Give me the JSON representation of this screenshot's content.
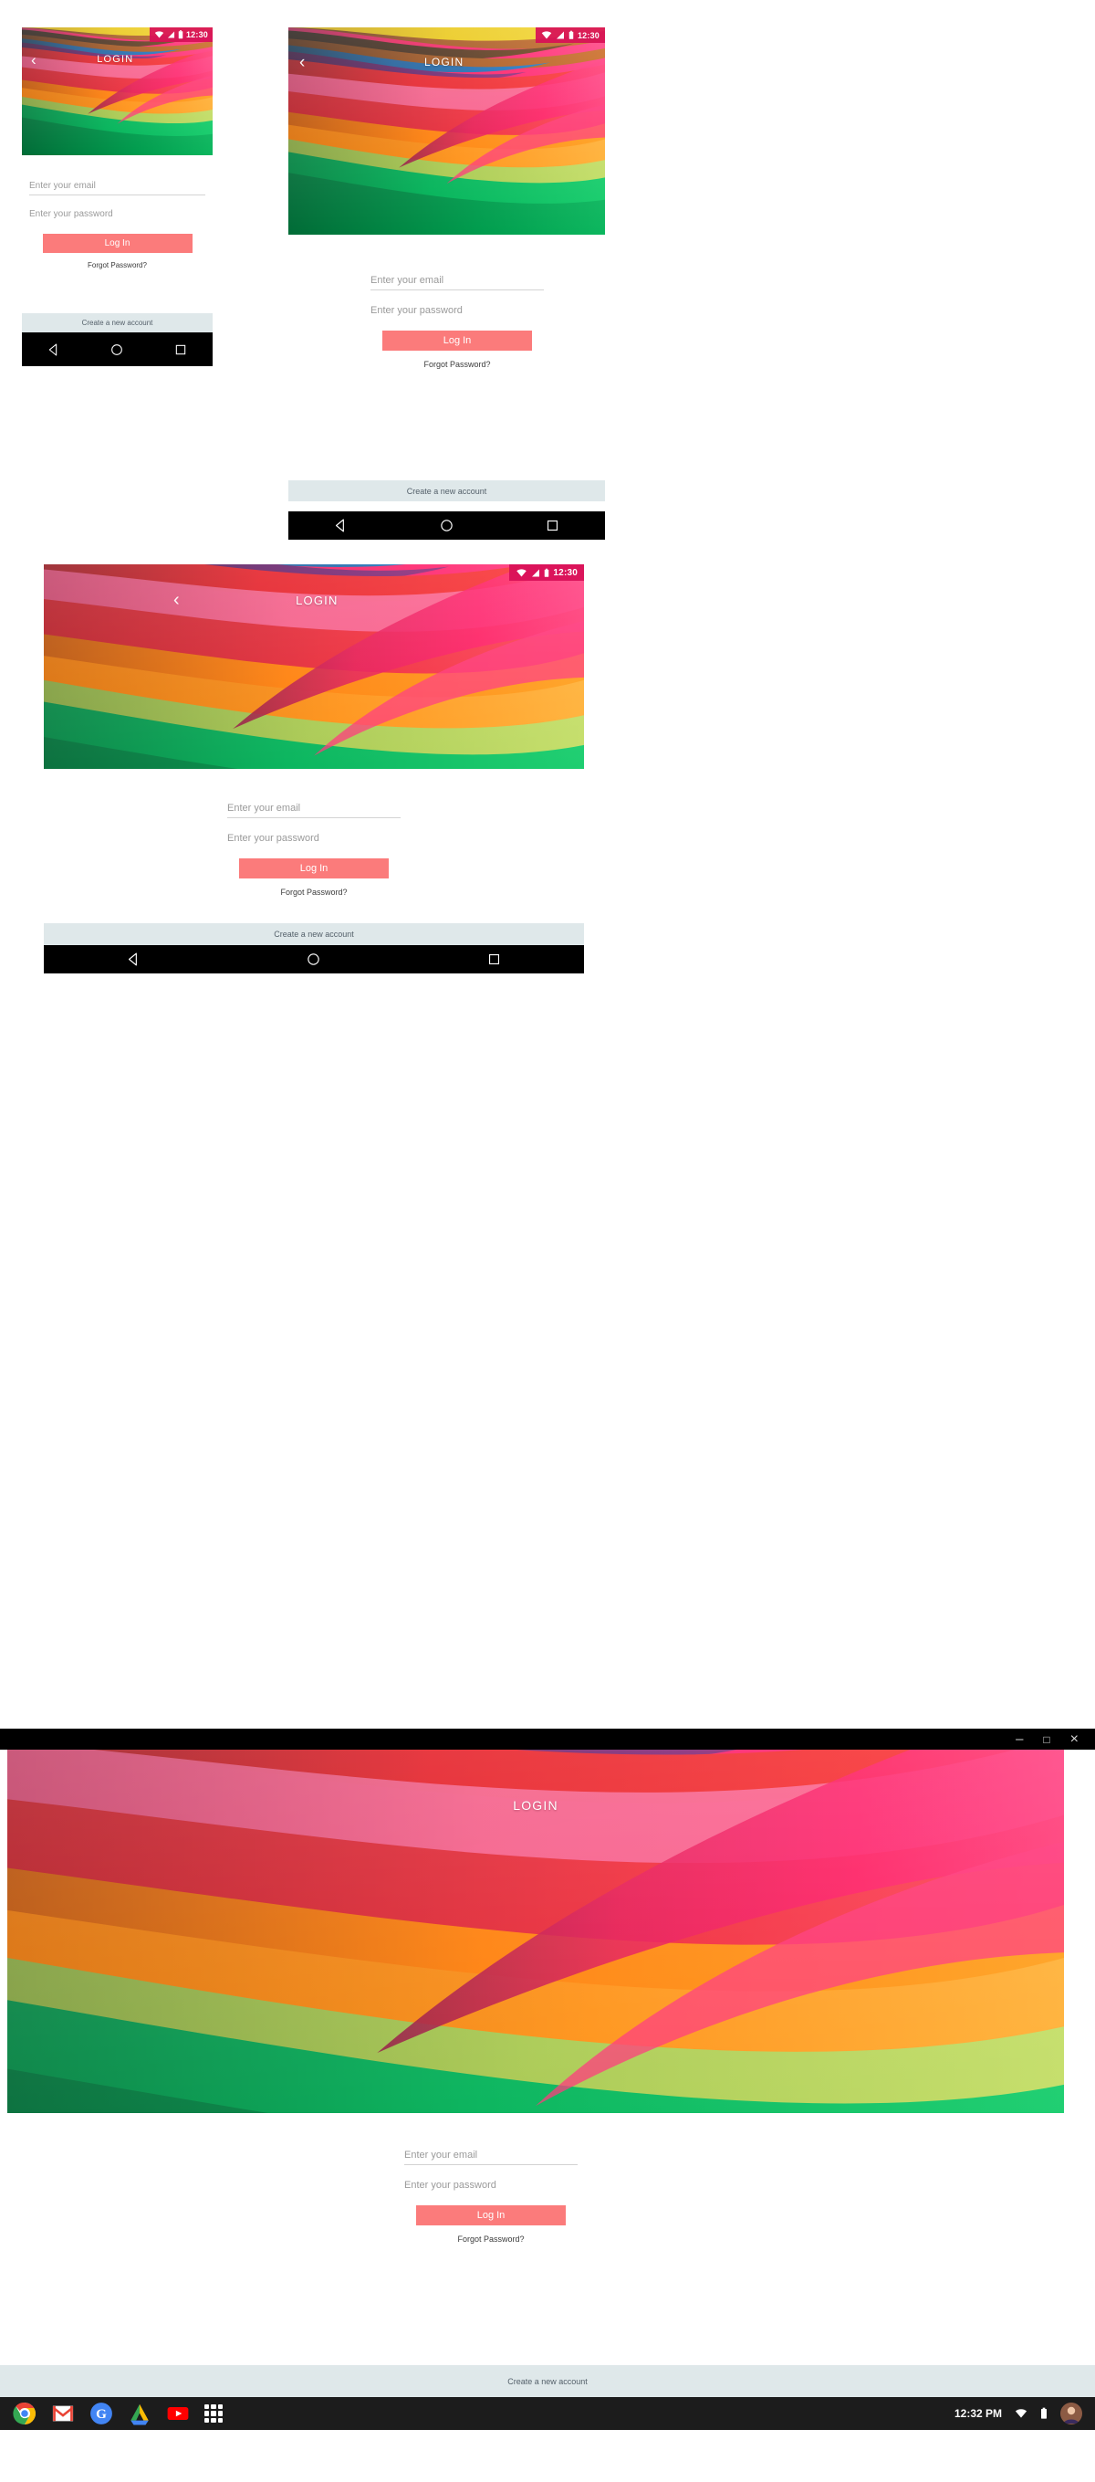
{
  "meta": {
    "screen_title": "LOGIN",
    "theme_accent": "#fb7b7b",
    "statusbar_bg": "#d80f57",
    "create_bar_bg": "#dfe8ea",
    "navbar_bg": "#000000"
  },
  "statusbar": {
    "time": "12:30",
    "icons": [
      "wifi-icon",
      "signal-icon",
      "battery-icon"
    ]
  },
  "appbar": {
    "back_glyph": "‹",
    "title": "LOGIN"
  },
  "form": {
    "email_placeholder": "Enter your email",
    "password_placeholder": "Enter your password",
    "login_label": "Log In",
    "forgot_label": "Forgot Password?"
  },
  "bottom": {
    "create_label": "Create a new account"
  },
  "navbar": {
    "back_label": "back-triangle-icon",
    "home_label": "home-circle-icon",
    "recents_label": "recents-square-icon"
  },
  "desktop": {
    "window_controls": {
      "minimize": "–",
      "maximize": "□",
      "close": "×"
    },
    "shelf": {
      "clock": "12:32 PM",
      "apps": [
        {
          "name": "chrome-icon",
          "label": "Chrome"
        },
        {
          "name": "gmail-icon",
          "label": "Gmail"
        },
        {
          "name": "google-search-icon",
          "label": "Google"
        },
        {
          "name": "google-drive-icon",
          "label": "Drive"
        },
        {
          "name": "youtube-icon",
          "label": "YouTube"
        },
        {
          "name": "app-launcher-grid-icon",
          "label": "All apps"
        }
      ],
      "tray": [
        {
          "name": "wifi-tray-icon"
        },
        {
          "name": "battery-tray-icon"
        },
        {
          "name": "user-avatar"
        }
      ]
    }
  },
  "mockups": [
    {
      "id": "phone-small",
      "label": "Phone portrait small"
    },
    {
      "id": "phone-medium",
      "label": "Phone portrait medium"
    },
    {
      "id": "tablet",
      "label": "Tablet landscape"
    },
    {
      "id": "desktop",
      "label": "Chrome OS desktop window"
    }
  ]
}
